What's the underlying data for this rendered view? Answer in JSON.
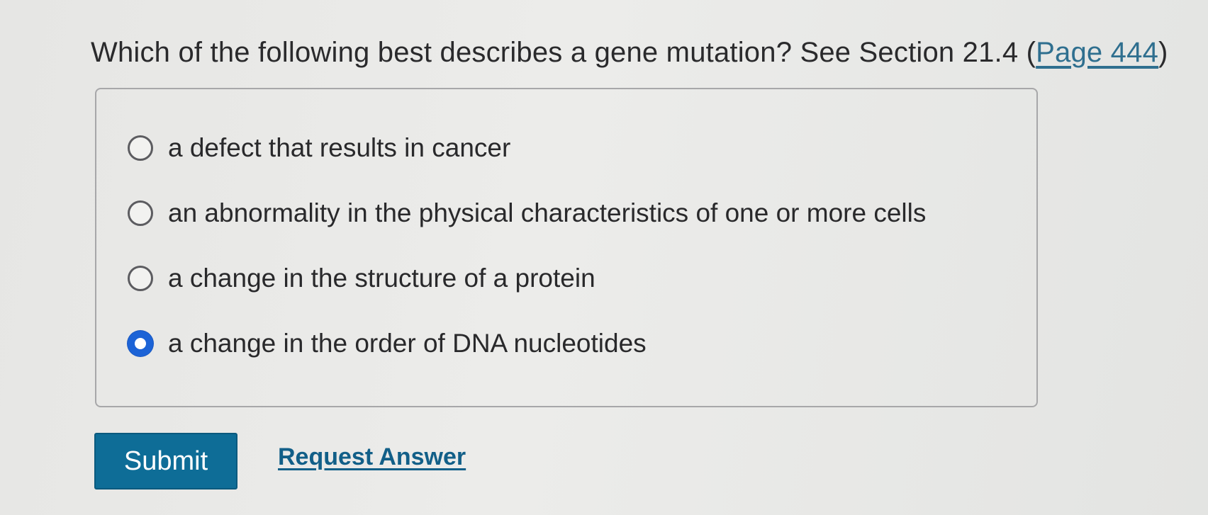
{
  "question": {
    "text": "Which of the following best describes a gene mutation? See Section 21.4 (",
    "link_label": "Page 444",
    "text_end": ")"
  },
  "options": [
    {
      "label": "a defect that results in cancer",
      "selected": false
    },
    {
      "label": "an abnormality in the physical characteristics of one or more cells",
      "selected": false
    },
    {
      "label": "a change in the structure of a protein",
      "selected": false
    },
    {
      "label": "a change in the order of DNA nucleotides",
      "selected": true
    }
  ],
  "actions": {
    "submit_label": "Submit",
    "request_answer_label": "Request Answer"
  },
  "colors": {
    "accent": "#1c63d6",
    "submit_bg": "#0e6d97",
    "link": "#125f88"
  }
}
